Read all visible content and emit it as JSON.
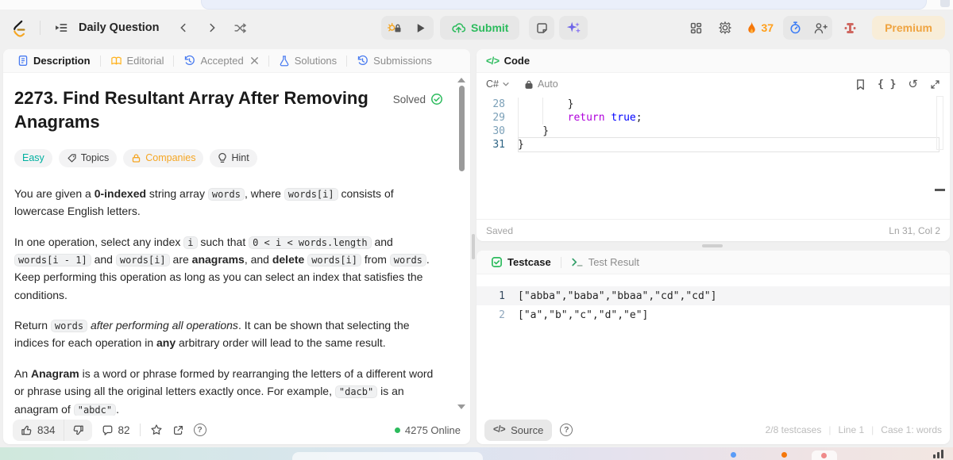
{
  "topbar": {
    "menu_label": "Daily Question",
    "submit_label": "Submit",
    "streak": "37",
    "premium": "Premium"
  },
  "icons": {
    "code_glyph": "</>",
    "braces_glyph": "{ }",
    "undo_glyph": "↺",
    "gear_glyph": "⚙",
    "help_glyph": "?"
  },
  "left": {
    "tabs": {
      "description": "Description",
      "editorial": "Editorial",
      "accepted": "Accepted",
      "solutions": "Solutions",
      "submissions": "Submissions"
    },
    "title": "2273. Find Resultant Array After Removing Anagrams",
    "solved": "Solved",
    "tags": {
      "difficulty": "Easy",
      "topics": "Topics",
      "companies": "Companies",
      "hint": "Hint"
    },
    "paragraphs": [
      [
        {
          "t": "You are given a "
        },
        {
          "t": "0-indexed",
          "s": "b"
        },
        {
          "t": " string array "
        },
        {
          "t": "words",
          "s": "code"
        },
        {
          "t": ", where "
        },
        {
          "t": "words[i]",
          "s": "code"
        },
        {
          "t": " consists of lowercase English letters."
        }
      ],
      [
        {
          "t": "In one operation, select any index "
        },
        {
          "t": "i",
          "s": "code"
        },
        {
          "t": " such that "
        },
        {
          "t": "0 < i < words.length",
          "s": "code"
        },
        {
          "t": " and "
        },
        {
          "t": "words[i - 1]",
          "s": "code"
        },
        {
          "t": " and "
        },
        {
          "t": "words[i]",
          "s": "code"
        },
        {
          "t": " are "
        },
        {
          "t": "anagrams",
          "s": "b"
        },
        {
          "t": ", and "
        },
        {
          "t": "delete",
          "s": "b"
        },
        {
          "t": " "
        },
        {
          "t": "words[i]",
          "s": "code"
        },
        {
          "t": " from "
        },
        {
          "t": "words",
          "s": "code"
        },
        {
          "t": ". Keep performing this operation as long as you can select an index that satisfies the conditions."
        }
      ],
      [
        {
          "t": "Return "
        },
        {
          "t": "words",
          "s": "code"
        },
        {
          "t": " "
        },
        {
          "t": "after performing all operations",
          "s": "i"
        },
        {
          "t": ". It can be shown that selecting the indices for each operation in "
        },
        {
          "t": "any",
          "s": "b"
        },
        {
          "t": " arbitrary order will lead to the same result."
        }
      ],
      [
        {
          "t": "An "
        },
        {
          "t": "Anagram",
          "s": "b"
        },
        {
          "t": " is a word or phrase formed by rearranging the letters of a different word or phrase using all the original letters exactly once. For example, "
        },
        {
          "t": "\"dacb\"",
          "s": "code"
        },
        {
          "t": " is an anagram of "
        },
        {
          "t": "\"abdc\"",
          "s": "code"
        },
        {
          "t": "."
        }
      ]
    ],
    "footer": {
      "likes": "834",
      "comments": "82",
      "online": "4275 Online"
    }
  },
  "code": {
    "title": "Code",
    "language": "C#",
    "auto": "Auto",
    "lines": [
      {
        "num": "28",
        "guides": [
          0,
          4
        ],
        "segments": [
          {
            "t": "        }",
            "c": "p"
          }
        ]
      },
      {
        "num": "29",
        "guides": [
          0,
          4
        ],
        "segments": [
          {
            "t": "        ",
            "c": "p"
          },
          {
            "t": "return",
            "c": "kw"
          },
          {
            "t": " ",
            "c": "p"
          },
          {
            "t": "true",
            "c": "lit"
          },
          {
            "t": ";",
            "c": "p"
          }
        ]
      },
      {
        "num": "30",
        "guides": [
          0
        ],
        "segments": [
          {
            "t": "    }",
            "c": "p"
          }
        ]
      },
      {
        "num": "31",
        "guides": [],
        "current": true,
        "segments": [
          {
            "t": "}",
            "c": "p"
          }
        ]
      }
    ],
    "saved": "Saved",
    "position": "Ln 31, Col 2"
  },
  "testcase": {
    "tab_testcase": "Testcase",
    "tab_result": "Test Result",
    "lines": [
      {
        "num": "1",
        "text": "[\"abba\",\"baba\",\"bbaa\",\"cd\",\"cd\"]",
        "selected": true
      },
      {
        "num": "2",
        "text": "[\"a\",\"b\",\"c\",\"d\",\"e\"]"
      }
    ],
    "source": "Source",
    "status": [
      "2/8 testcases",
      "Line 1",
      "Case 1: words"
    ]
  },
  "colors": {
    "brand_green": "#2cbb5d",
    "brand_orange": "#ffa116",
    "easy_teal": "#01b0a0",
    "keyword_purple": "#af00db",
    "literal_blue": "#0000ff"
  }
}
